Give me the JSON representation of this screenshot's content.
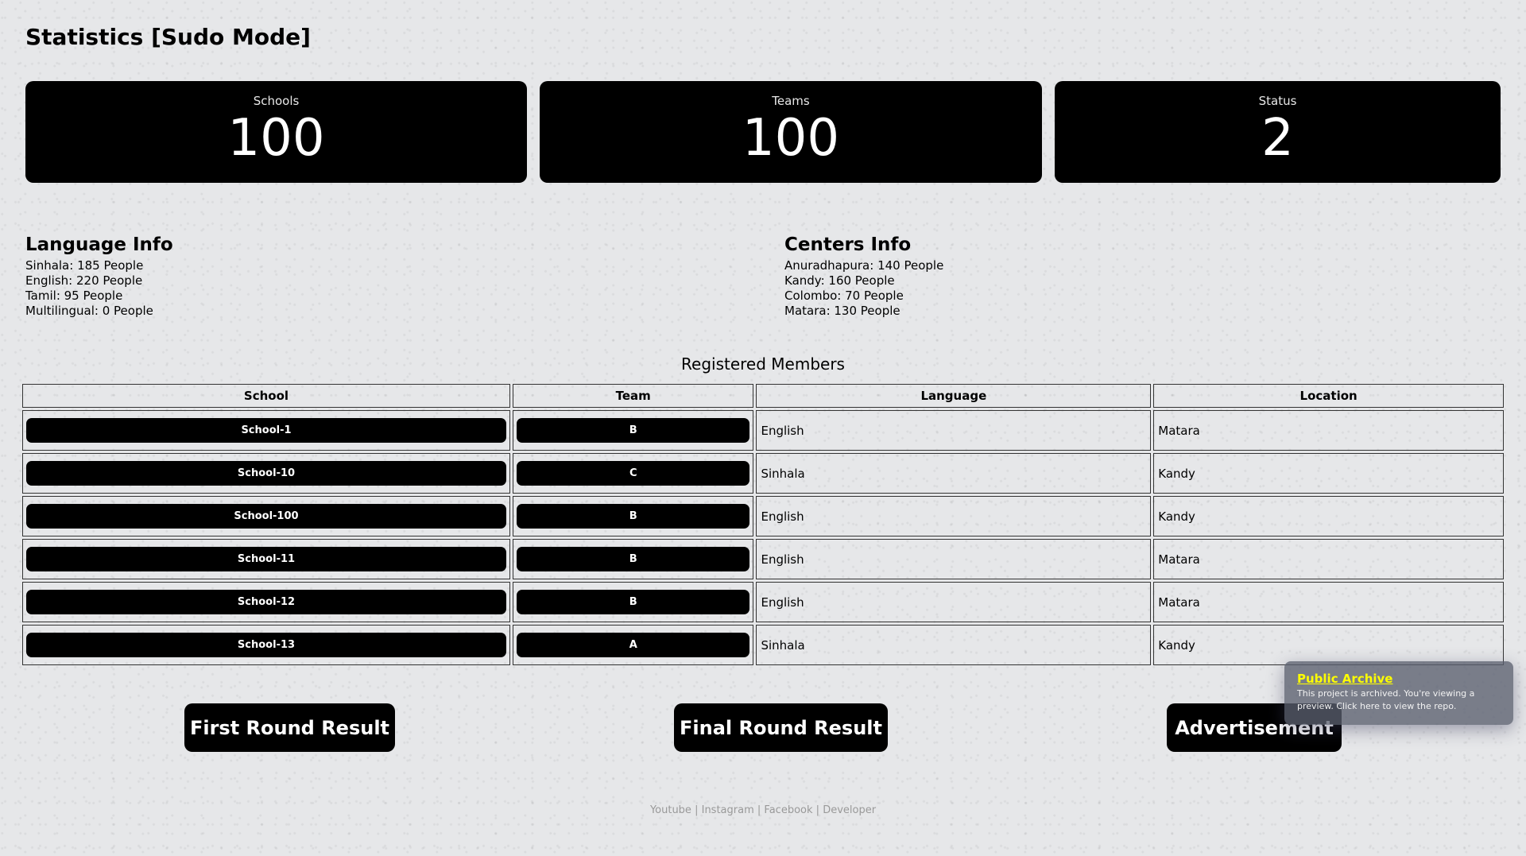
{
  "page": {
    "title": "Statistics [Sudo Mode]"
  },
  "stats": [
    {
      "label": "Schools",
      "value": "100"
    },
    {
      "label": "Teams",
      "value": "100"
    },
    {
      "label": "Status",
      "value": "2"
    }
  ],
  "language_info": {
    "title": "Language Info",
    "rows": [
      "Sinhala: 185 People",
      "English: 220 People",
      "Tamil: 95 People",
      "Multilingual: 0 People"
    ]
  },
  "centers_info": {
    "title": "Centers Info",
    "rows": [
      "Anuradhapura: 140 People",
      "Kandy: 160 People",
      "Colombo: 70 People",
      "Matara: 130 People"
    ]
  },
  "table": {
    "caption": "Registered Members",
    "columns": [
      "School",
      "Team",
      "Language",
      "Location"
    ],
    "rows": [
      {
        "school": "School-1",
        "team": "B",
        "language": "English",
        "location": "Matara"
      },
      {
        "school": "School-10",
        "team": "C",
        "language": "Sinhala",
        "location": "Kandy"
      },
      {
        "school": "School-100",
        "team": "B",
        "language": "English",
        "location": "Kandy"
      },
      {
        "school": "School-11",
        "team": "B",
        "language": "English",
        "location": "Matara"
      },
      {
        "school": "School-12",
        "team": "B",
        "language": "English",
        "location": "Matara"
      },
      {
        "school": "School-13",
        "team": "A",
        "language": "Sinhala",
        "location": "Kandy"
      }
    ]
  },
  "buttons": {
    "first_round": "First Round Result",
    "final_round": "Final Round Result",
    "advertisement": "Advertisement"
  },
  "footer": {
    "youtube": "Youtube",
    "instagram": "Instagram",
    "facebook": "Facebook",
    "developer": "Developer",
    "separator": "|"
  },
  "archive_toast": {
    "title": "Public Archive",
    "body": "This project is archived. You're viewing a preview. Click here to view the repo."
  },
  "colors": {
    "background": "#e6e7e9",
    "card": "#000000",
    "toast_title": "#ffff00"
  }
}
